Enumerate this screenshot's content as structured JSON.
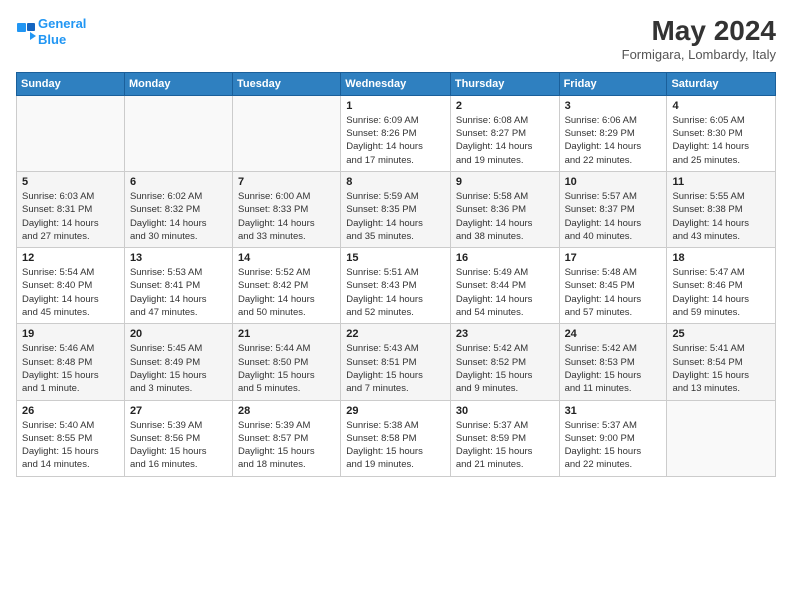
{
  "logo": {
    "line1": "General",
    "line2": "Blue",
    "icon": "▶"
  },
  "title": "May 2024",
  "subtitle": "Formigara, Lombardy, Italy",
  "days_header": [
    "Sunday",
    "Monday",
    "Tuesday",
    "Wednesday",
    "Thursday",
    "Friday",
    "Saturday"
  ],
  "weeks": [
    [
      {
        "num": "",
        "info": ""
      },
      {
        "num": "",
        "info": ""
      },
      {
        "num": "",
        "info": ""
      },
      {
        "num": "1",
        "info": "Sunrise: 6:09 AM\nSunset: 8:26 PM\nDaylight: 14 hours\nand 17 minutes."
      },
      {
        "num": "2",
        "info": "Sunrise: 6:08 AM\nSunset: 8:27 PM\nDaylight: 14 hours\nand 19 minutes."
      },
      {
        "num": "3",
        "info": "Sunrise: 6:06 AM\nSunset: 8:29 PM\nDaylight: 14 hours\nand 22 minutes."
      },
      {
        "num": "4",
        "info": "Sunrise: 6:05 AM\nSunset: 8:30 PM\nDaylight: 14 hours\nand 25 minutes."
      }
    ],
    [
      {
        "num": "5",
        "info": "Sunrise: 6:03 AM\nSunset: 8:31 PM\nDaylight: 14 hours\nand 27 minutes."
      },
      {
        "num": "6",
        "info": "Sunrise: 6:02 AM\nSunset: 8:32 PM\nDaylight: 14 hours\nand 30 minutes."
      },
      {
        "num": "7",
        "info": "Sunrise: 6:00 AM\nSunset: 8:33 PM\nDaylight: 14 hours\nand 33 minutes."
      },
      {
        "num": "8",
        "info": "Sunrise: 5:59 AM\nSunset: 8:35 PM\nDaylight: 14 hours\nand 35 minutes."
      },
      {
        "num": "9",
        "info": "Sunrise: 5:58 AM\nSunset: 8:36 PM\nDaylight: 14 hours\nand 38 minutes."
      },
      {
        "num": "10",
        "info": "Sunrise: 5:57 AM\nSunset: 8:37 PM\nDaylight: 14 hours\nand 40 minutes."
      },
      {
        "num": "11",
        "info": "Sunrise: 5:55 AM\nSunset: 8:38 PM\nDaylight: 14 hours\nand 43 minutes."
      }
    ],
    [
      {
        "num": "12",
        "info": "Sunrise: 5:54 AM\nSunset: 8:40 PM\nDaylight: 14 hours\nand 45 minutes."
      },
      {
        "num": "13",
        "info": "Sunrise: 5:53 AM\nSunset: 8:41 PM\nDaylight: 14 hours\nand 47 minutes."
      },
      {
        "num": "14",
        "info": "Sunrise: 5:52 AM\nSunset: 8:42 PM\nDaylight: 14 hours\nand 50 minutes."
      },
      {
        "num": "15",
        "info": "Sunrise: 5:51 AM\nSunset: 8:43 PM\nDaylight: 14 hours\nand 52 minutes."
      },
      {
        "num": "16",
        "info": "Sunrise: 5:49 AM\nSunset: 8:44 PM\nDaylight: 14 hours\nand 54 minutes."
      },
      {
        "num": "17",
        "info": "Sunrise: 5:48 AM\nSunset: 8:45 PM\nDaylight: 14 hours\nand 57 minutes."
      },
      {
        "num": "18",
        "info": "Sunrise: 5:47 AM\nSunset: 8:46 PM\nDaylight: 14 hours\nand 59 minutes."
      }
    ],
    [
      {
        "num": "19",
        "info": "Sunrise: 5:46 AM\nSunset: 8:48 PM\nDaylight: 15 hours\nand 1 minute."
      },
      {
        "num": "20",
        "info": "Sunrise: 5:45 AM\nSunset: 8:49 PM\nDaylight: 15 hours\nand 3 minutes."
      },
      {
        "num": "21",
        "info": "Sunrise: 5:44 AM\nSunset: 8:50 PM\nDaylight: 15 hours\nand 5 minutes."
      },
      {
        "num": "22",
        "info": "Sunrise: 5:43 AM\nSunset: 8:51 PM\nDaylight: 15 hours\nand 7 minutes."
      },
      {
        "num": "23",
        "info": "Sunrise: 5:42 AM\nSunset: 8:52 PM\nDaylight: 15 hours\nand 9 minutes."
      },
      {
        "num": "24",
        "info": "Sunrise: 5:42 AM\nSunset: 8:53 PM\nDaylight: 15 hours\nand 11 minutes."
      },
      {
        "num": "25",
        "info": "Sunrise: 5:41 AM\nSunset: 8:54 PM\nDaylight: 15 hours\nand 13 minutes."
      }
    ],
    [
      {
        "num": "26",
        "info": "Sunrise: 5:40 AM\nSunset: 8:55 PM\nDaylight: 15 hours\nand 14 minutes."
      },
      {
        "num": "27",
        "info": "Sunrise: 5:39 AM\nSunset: 8:56 PM\nDaylight: 15 hours\nand 16 minutes."
      },
      {
        "num": "28",
        "info": "Sunrise: 5:39 AM\nSunset: 8:57 PM\nDaylight: 15 hours\nand 18 minutes."
      },
      {
        "num": "29",
        "info": "Sunrise: 5:38 AM\nSunset: 8:58 PM\nDaylight: 15 hours\nand 19 minutes."
      },
      {
        "num": "30",
        "info": "Sunrise: 5:37 AM\nSunset: 8:59 PM\nDaylight: 15 hours\nand 21 minutes."
      },
      {
        "num": "31",
        "info": "Sunrise: 5:37 AM\nSunset: 9:00 PM\nDaylight: 15 hours\nand 22 minutes."
      },
      {
        "num": "",
        "info": ""
      }
    ]
  ],
  "colors": {
    "header_bg": "#2F80C0",
    "header_text": "#ffffff",
    "row_odd": "#ffffff",
    "row_even": "#f5f5f5"
  }
}
